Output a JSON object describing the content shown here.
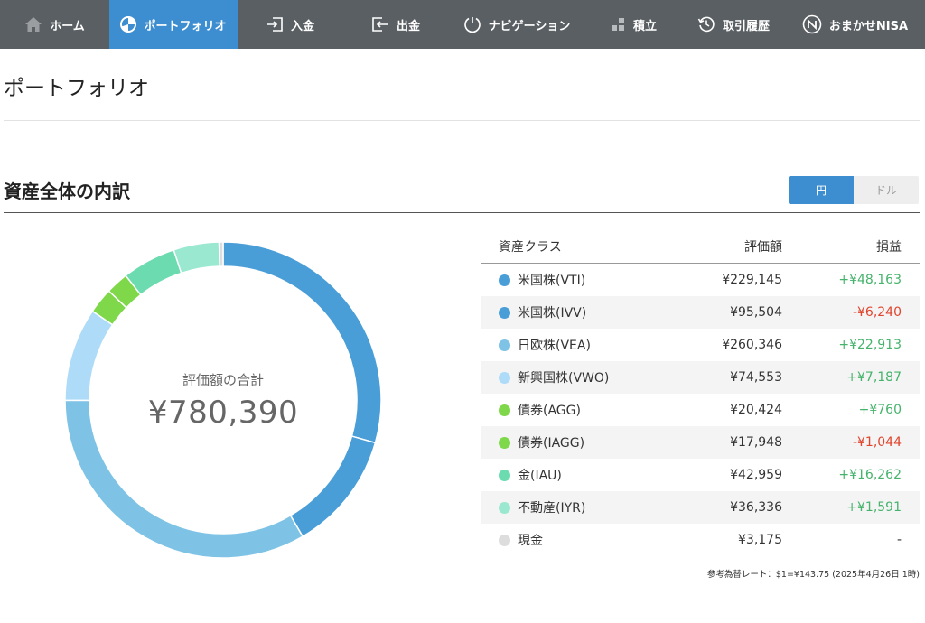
{
  "nav": {
    "items": [
      {
        "label": "ホーム",
        "icon": "home-icon"
      },
      {
        "label": "ポートフォリオ",
        "icon": "pie-chart-icon"
      },
      {
        "label": "入金",
        "icon": "sign-in-icon"
      },
      {
        "label": "出金",
        "icon": "sign-out-icon"
      },
      {
        "label": "ナビゲーション",
        "icon": "gauge-icon"
      },
      {
        "label": "積立",
        "icon": "blocks-icon"
      },
      {
        "label": "取引履歴",
        "icon": "history-icon"
      },
      {
        "label": "おまかせNISA",
        "icon": "nisa-logo-icon"
      }
    ],
    "active_index": 1
  },
  "page": {
    "title": "ポートフォリオ",
    "section_title": "資産全体の内訳"
  },
  "currency_toggle": {
    "yen": "円",
    "usd": "ドル",
    "selected": "円"
  },
  "summary": {
    "label": "評価額の合計",
    "total": "¥780,390"
  },
  "table": {
    "headers": {
      "asset_class": "資産クラス",
      "value": "評価額",
      "pl": "損益"
    },
    "rows": [
      {
        "name": "米国株(VTI)",
        "value": "¥229,145",
        "pl": "+¥48,163",
        "pl_sign": "pos",
        "color": "#4a9ed8"
      },
      {
        "name": "米国株(IVV)",
        "value": "¥95,504",
        "pl": "-¥6,240",
        "pl_sign": "neg",
        "color": "#4a9ed8"
      },
      {
        "name": "日欧株(VEA)",
        "value": "¥260,346",
        "pl": "+¥22,913",
        "pl_sign": "pos",
        "color": "#7ec3e6"
      },
      {
        "name": "新興国株(VWO)",
        "value": "¥74,553",
        "pl": "+¥7,187",
        "pl_sign": "pos",
        "color": "#aedcf8"
      },
      {
        "name": "債券(AGG)",
        "value": "¥20,424",
        "pl": "+¥760",
        "pl_sign": "pos",
        "color": "#7ed84a"
      },
      {
        "name": "債券(IAGG)",
        "value": "¥17,948",
        "pl": "-¥1,044",
        "pl_sign": "neg",
        "color": "#7ed84a"
      },
      {
        "name": "金(IAU)",
        "value": "¥42,959",
        "pl": "+¥16,262",
        "pl_sign": "pos",
        "color": "#6ddbb0"
      },
      {
        "name": "不動産(IYR)",
        "value": "¥36,336",
        "pl": "+¥1,591",
        "pl_sign": "pos",
        "color": "#9ae8d0"
      },
      {
        "name": "現金",
        "value": "¥3,175",
        "pl": "-",
        "pl_sign": "neutral",
        "color": "#dddddd"
      }
    ]
  },
  "chart_data": {
    "type": "pie",
    "categories": [
      "米国株(VTI)",
      "米国株(IVV)",
      "日欧株(VEA)",
      "新興国株(VWO)",
      "債券(AGG)",
      "債券(IAGG)",
      "金(IAU)",
      "不動産(IYR)",
      "現金"
    ],
    "values": [
      229145,
      95504,
      260346,
      74553,
      20424,
      17948,
      42959,
      36336,
      3175
    ],
    "colors": [
      "#4a9ed8",
      "#4a9ed8",
      "#7ec3e6",
      "#aedcf8",
      "#7ed84a",
      "#7ed84a",
      "#6ddbb0",
      "#9ae8d0",
      "#dddddd"
    ],
    "title": "",
    "donut": true
  },
  "fx_note": "参考為替レート：$1=¥143.75 (2025年4月26日 1時)"
}
